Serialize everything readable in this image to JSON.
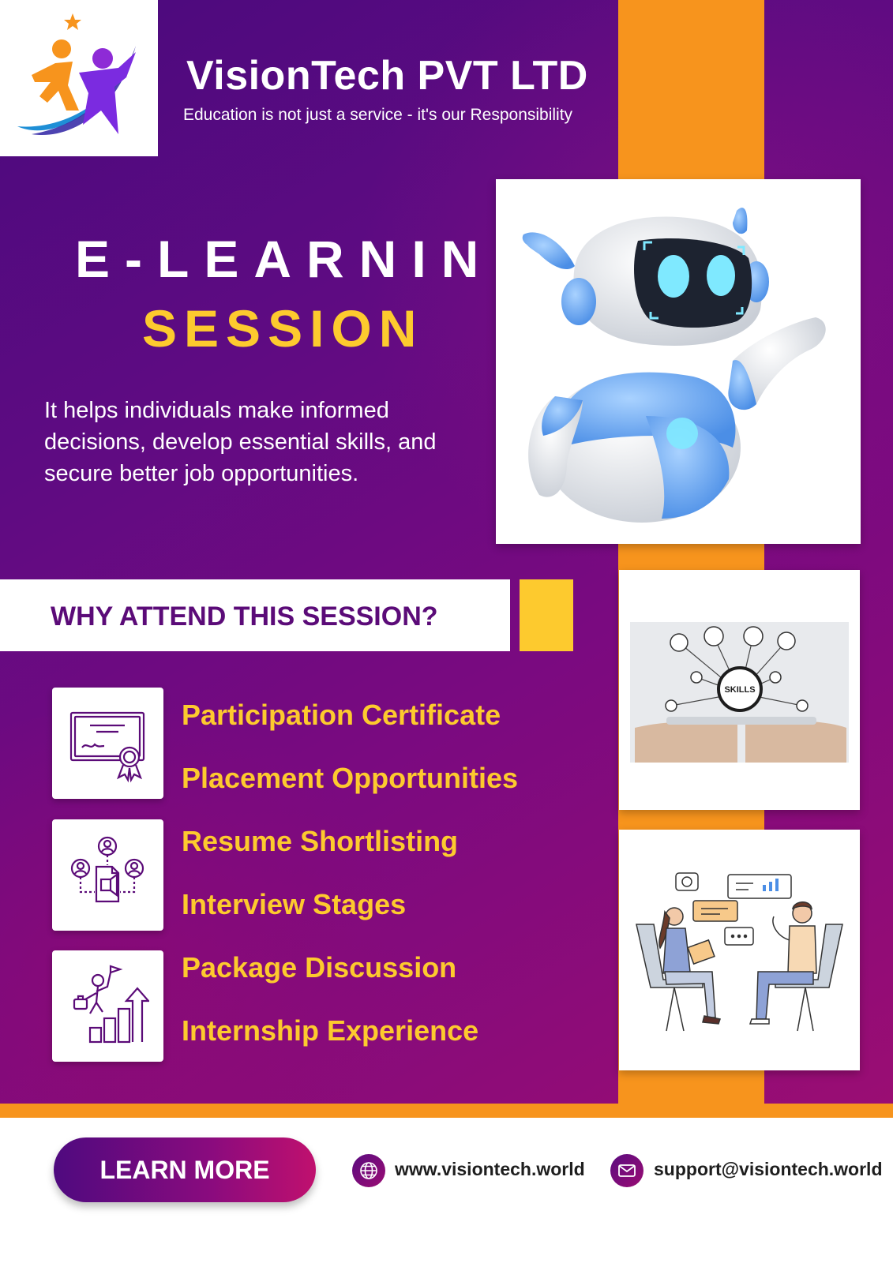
{
  "header": {
    "company_name": "VisionTech PVT LTD",
    "tagline": "Education is not just a service - it's our Responsibility"
  },
  "hero": {
    "title_line1": "E-LEARNING",
    "title_line2": "SESSION",
    "description": "It helps individuals make informed decisions, develop essential skills, and secure better job opportunities."
  },
  "why_section": {
    "heading": "WHY ATTEND THIS SESSION?",
    "benefits": [
      "Participation Certificate",
      "Placement Opportunities",
      "Resume Shortlisting",
      "Interview Stages",
      "Package Discussion",
      "Internship Experience"
    ]
  },
  "skills_image": {
    "label": "SKILLS"
  },
  "footer": {
    "cta_label": "LEARN MORE",
    "website": "www.visiontech.world",
    "email": "support@visiontech.world"
  },
  "colors": {
    "purple": "#5b0b78",
    "magenta": "#9a0d73",
    "orange": "#f7941d",
    "yellow": "#fdca2e"
  },
  "icons": [
    "logo-star-figures",
    "certificate-icon",
    "network-people-icon",
    "career-growth-icon",
    "globe-icon",
    "mail-icon"
  ]
}
